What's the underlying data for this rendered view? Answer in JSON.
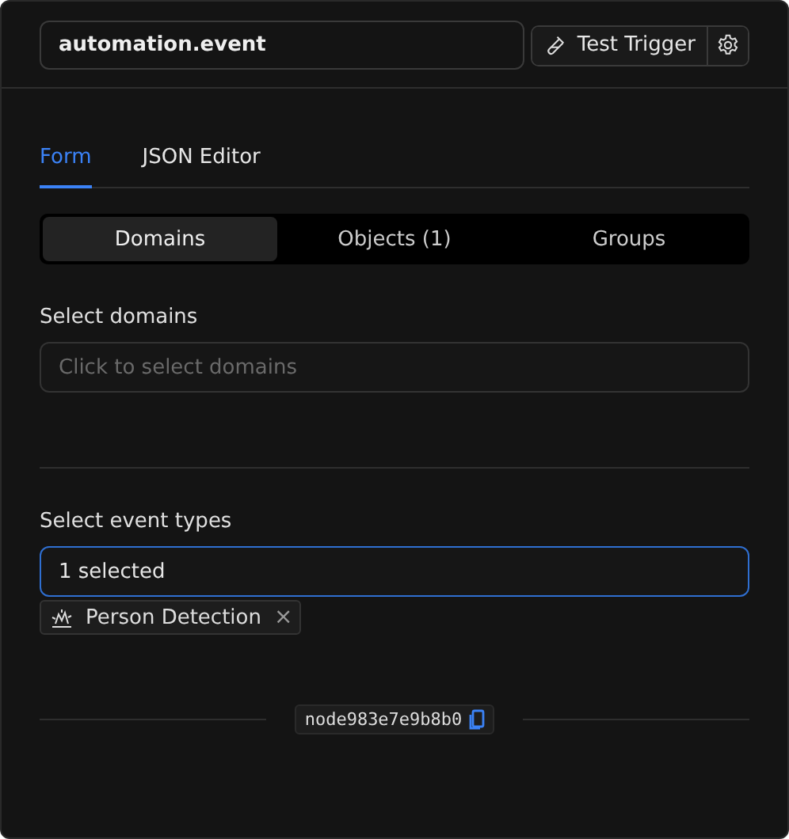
{
  "header": {
    "name_value": "automation.event",
    "test_button": "Test Trigger"
  },
  "tabs": [
    {
      "label": "Form",
      "selected": true
    },
    {
      "label": "JSON Editor",
      "selected": false
    }
  ],
  "segments": [
    {
      "label": "Domains",
      "selected": true
    },
    {
      "label": "Objects (1)",
      "selected": false
    },
    {
      "label": "Groups",
      "selected": false
    }
  ],
  "domains": {
    "label": "Select domains",
    "placeholder": "Click to select domains",
    "focused": false
  },
  "event_types": {
    "label": "Select event types",
    "value": "1 selected",
    "focused": true,
    "chips": [
      {
        "label": "Person Detection",
        "remove": "×"
      }
    ]
  },
  "node_id": "node983e7e9b8b0"
}
